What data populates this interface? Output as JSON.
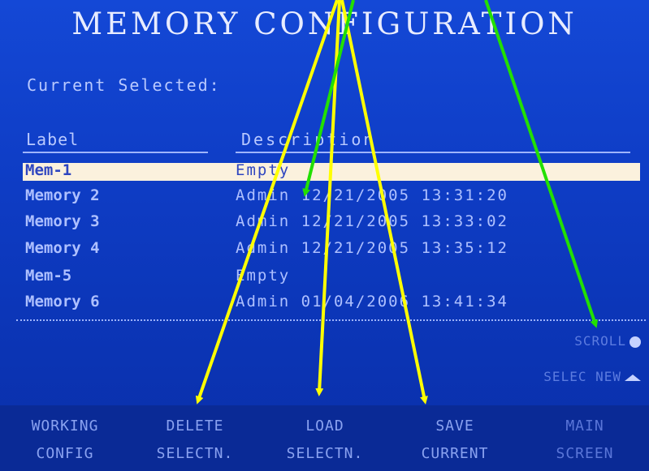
{
  "title": "MEMORY CONFIGURATION",
  "current_selected_label": "Current Selected:",
  "table": {
    "headers": {
      "label": "Label",
      "description": "Description"
    },
    "rows": [
      {
        "label": "Mem-1",
        "description": "Empty"
      },
      {
        "label": "Memory 2",
        "description": "Admin 12/21/2005 13:31:20"
      },
      {
        "label": "Memory 3",
        "description": "Admin 12/21/2005 13:33:02"
      },
      {
        "label": "Memory 4",
        "description": "Admin 12/21/2005 13:35:12"
      },
      {
        "label": "Mem-5",
        "description": "Empty"
      },
      {
        "label": "Memory 6",
        "description": "Admin 01/04/2006 13:41:34"
      }
    ],
    "selected_index": 0
  },
  "side_controls": {
    "scroll": "SCROLL",
    "select_new": "SELEC NEW"
  },
  "softkeys": [
    {
      "line1": "WORKING",
      "line2": "CONFIG"
    },
    {
      "line1": "DELETE",
      "line2": "SELECTN."
    },
    {
      "line1": "LOAD",
      "line2": "SELECTN."
    },
    {
      "line1": "SAVE",
      "line2": "CURRENT"
    },
    {
      "line1": "MAIN",
      "line2": "SCREEN"
    }
  ],
  "colors": {
    "screen_bg": "#1448d6",
    "arrow_yellow": "#ffff00",
    "arrow_green": "#22e000",
    "selected_row_bg": "#fbf1dd"
  }
}
